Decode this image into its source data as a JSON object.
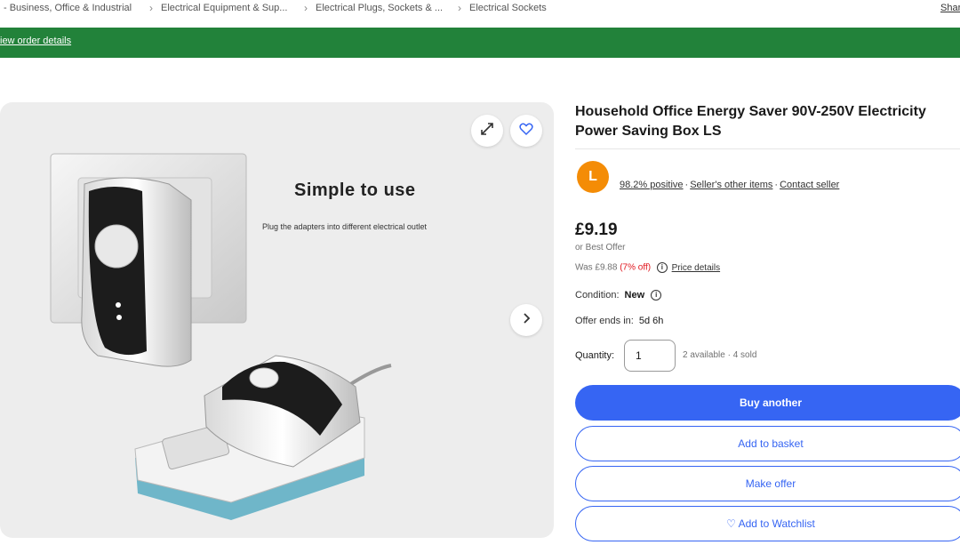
{
  "breadcrumb": {
    "items": [
      "- Business, Office & Industrial",
      "Electrical Equipment & Sup...",
      "Electrical Plugs, Sockets & ...",
      "Electrical Sockets"
    ],
    "share_label": "Share"
  },
  "banner": {
    "link_text": "iew order details",
    "color": "#22823a"
  },
  "gallery": {
    "headline": "Simple to use",
    "subline": "Plug the adapters into different electrical outlet",
    "expand_icon": "expand-icon",
    "watch_icon": "heart-icon",
    "next_icon": "chevron-right-icon"
  },
  "product": {
    "title_line1": "Household Office Energy Saver 90V-250V Electricity",
    "title_line2": "Power Saving Box LS"
  },
  "seller": {
    "avatar_letter": "L",
    "feedback": "98.2% positive",
    "other_items": "Seller's other items",
    "contact": "Contact seller"
  },
  "pricing": {
    "price": "£9.19",
    "best_offer": "or Best Offer",
    "was_prefix": "Was £9.88",
    "discount": "(7% off)",
    "price_details": "Price details"
  },
  "condition": {
    "label": "Condition:",
    "value": "New"
  },
  "offer": {
    "label": "Offer ends in:",
    "value": "5d 6h"
  },
  "quantity": {
    "label": "Quantity:",
    "value": "1",
    "available": "2 available · 4 sold"
  },
  "actions": {
    "buy": "Buy another",
    "basket": "Add to basket",
    "offer": "Make offer",
    "watchlist": "♡ Add to Watchlist"
  },
  "colors": {
    "primary_blue": "#3665f3",
    "avatar_orange": "#f48c06",
    "discount_red": "#e0141c"
  }
}
